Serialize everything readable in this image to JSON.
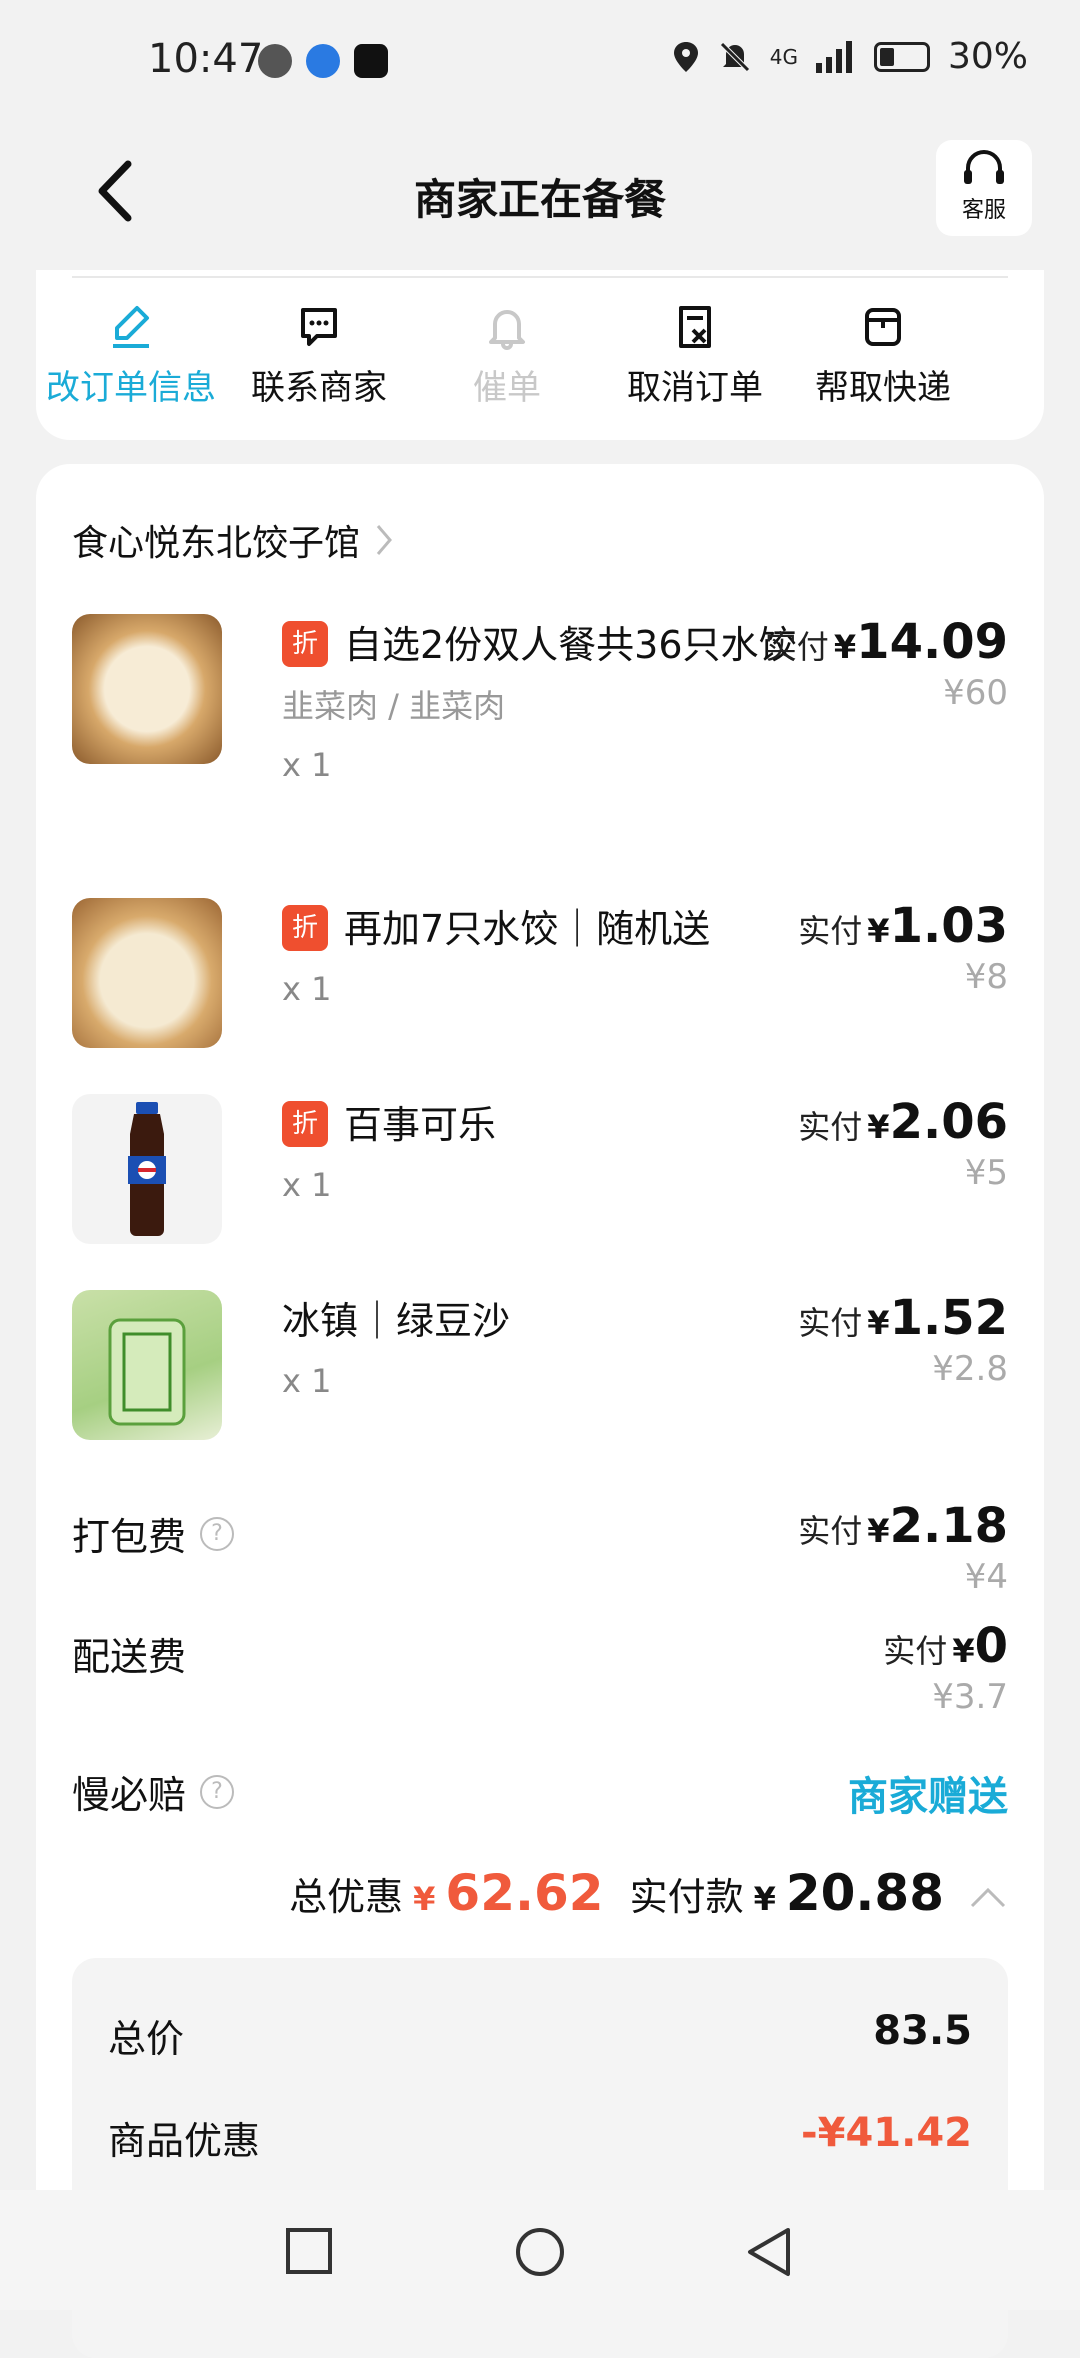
{
  "status_bar": {
    "time": "10:47",
    "network": "4G",
    "battery": "30%"
  },
  "header": {
    "title": "商家正在备餐",
    "service_label": "客服"
  },
  "actions": [
    {
      "label": "改订单信息",
      "icon": "pencil-icon",
      "active": true
    },
    {
      "label": "联系商家",
      "icon": "chat-icon",
      "active": false
    },
    {
      "label": "催单",
      "icon": "bell-icon",
      "disabled": true
    },
    {
      "label": "取消订单",
      "icon": "cancel-order-icon",
      "active": false
    },
    {
      "label": "帮取快递",
      "icon": "package-icon",
      "active": false
    }
  ],
  "shop": {
    "name": "食心悦东北饺子馆"
  },
  "items": [
    {
      "badge": "折",
      "name": "自选2份双人餐共36只水饺",
      "spec": "韭菜肉 / 韭菜肉",
      "qty": "x 1",
      "pay_label": "实付",
      "currency": "¥",
      "pay": "14.09",
      "orig": "¥60"
    },
    {
      "badge": "折",
      "name": "再加7只水饺｜随机送",
      "qty": "x 1",
      "pay_label": "实付",
      "currency": "¥",
      "pay": "1.03",
      "orig": "¥8"
    },
    {
      "badge": "折",
      "name": "百事可乐",
      "qty": "x 1",
      "pay_label": "实付",
      "currency": "¥",
      "pay": "2.06",
      "orig": "¥5"
    },
    {
      "name": "冰镇｜绿豆沙",
      "qty": "x 1",
      "pay_label": "实付",
      "currency": "¥",
      "pay": "1.52",
      "orig": "¥2.8"
    }
  ],
  "fees": {
    "packing": {
      "label": "打包费",
      "pay_label": "实付",
      "currency": "¥",
      "pay": "2.18",
      "orig": "¥4"
    },
    "delivery": {
      "label": "配送费",
      "pay_label": "实付",
      "currency": "¥",
      "pay": "0",
      "orig": "¥3.7"
    },
    "slow": {
      "label": "慢必赔",
      "value": "商家赠送"
    }
  },
  "summary": {
    "discount_label": "总优惠",
    "discount_currency": "¥",
    "discount": "62.62",
    "paid_label": "实付款",
    "paid_currency": "¥",
    "paid": "20.88"
  },
  "breakdown": [
    {
      "label": "总价",
      "value": "83.5"
    },
    {
      "label": "商品优惠",
      "value": "-¥41.42"
    }
  ],
  "colors": {
    "accent": "#1aabd7",
    "red": "#f05a3c",
    "badge": "#ef4f2f"
  }
}
